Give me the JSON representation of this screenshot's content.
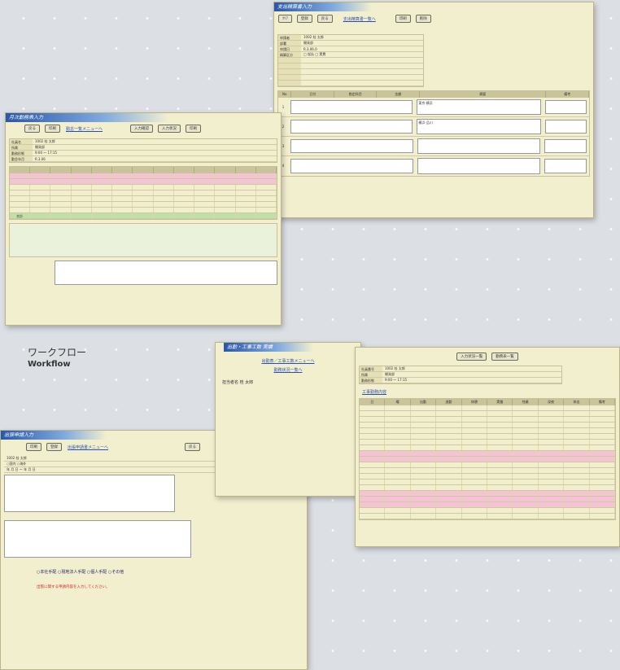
{
  "caption": {
    "japanese": "ワークフロー",
    "english": "Workflow"
  },
  "window_a": {
    "title": "支出精算書入力",
    "buttons": [
      "ｸﾘｱ",
      "登録",
      "戻る"
    ],
    "link": "支出精算書一覧へ",
    "right_buttons": [
      "印刷",
      "削除"
    ],
    "fields": [
      {
        "label": "申請者",
        "value": "1002  桂  太郎"
      },
      {
        "label": "部署",
        "value": "開発部"
      },
      {
        "label": "申請日",
        "value": "R.3.06.0"
      },
      {
        "label": "精算区分",
        "value": "□ 仮払  □ 実費"
      }
    ],
    "table_headers": [
      "No",
      "日付",
      "勘定科目",
      "金額",
      "摘要",
      "備考"
    ],
    "rows": [
      {
        "no": "1",
        "memo": "東京-横浜"
      },
      {
        "no": "2",
        "memo": "横浜-品川"
      },
      {
        "no": "3",
        "memo": ""
      },
      {
        "no": "4",
        "memo": ""
      }
    ]
  },
  "window_b": {
    "title": "月次勤務表入力",
    "buttons": [
      "戻る",
      "印刷"
    ],
    "link": "勤怠一覧メニューへ",
    "right_buttons": [
      "入力確認",
      "入力状況",
      "印刷"
    ],
    "fields": [
      {
        "label": "社員名",
        "value": "1002  桂  太郎"
      },
      {
        "label": "所属",
        "value": "開発部"
      },
      {
        "label": "勤務形態",
        "value": "9:00 ～ 17:15"
      },
      {
        "label": "勤怠年月",
        "value": "R.3.06"
      }
    ],
    "total_label": "合計",
    "grid_rows": 8
  },
  "window_c": {
    "title": "出張申請入力",
    "buttons": [
      "印刷",
      "登録"
    ],
    "link": "出張申請書メニューへ",
    "right_button": "戻る",
    "fields": [
      {
        "label": "申請者",
        "value": "1002  桂  太郎"
      },
      {
        "label": "区分",
        "value": "○国内 ○海外"
      },
      {
        "label": "期間",
        "value": "年 月 日 ～ 年 月 日"
      }
    ],
    "note": "出張に関する申請内容を入力してください。",
    "radio_options": "○本社手配 ○現地法人手配 ○個人手配 ○その他"
  },
  "window_d": {
    "title": "出勤・工事工数 実績",
    "links": [
      "出勤表／工事工数メニューへ",
      "勤務状況一覧へ"
    ],
    "worker": "担当者名  桂  太郎"
  },
  "window_e": {
    "buttons": [
      "入力状況一覧",
      "勤務表一覧"
    ],
    "fields": [
      {
        "label": "社員番号",
        "value": "1002  桂  太郎"
      },
      {
        "label": "所属",
        "value": "開発部"
      },
      {
        "label": "勤務形態",
        "value": "9:00 ～ 17:15"
      }
    ],
    "headline": "工事勤務内容",
    "table_headers": [
      "日",
      "曜",
      "出勤",
      "退勤",
      "休憩",
      "実働",
      "残業",
      "深夜",
      "休出",
      "備考"
    ],
    "rows": 20
  }
}
